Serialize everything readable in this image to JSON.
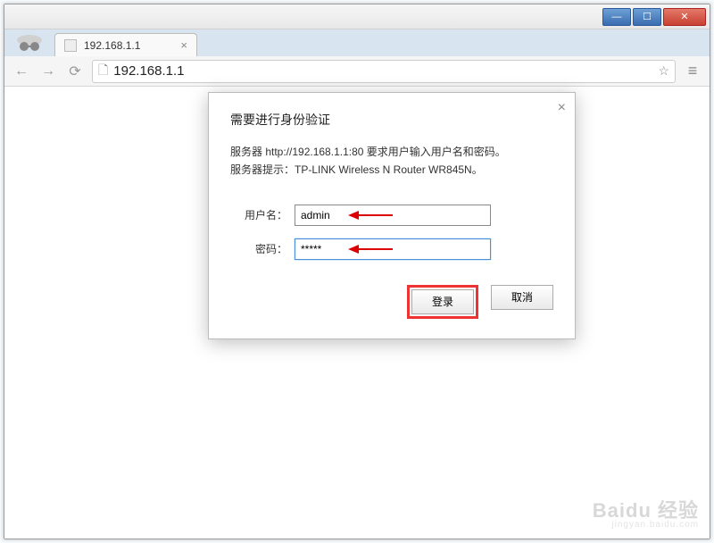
{
  "window": {
    "min_glyph": "—",
    "max_glyph": "☐",
    "close_glyph": "✕"
  },
  "tab": {
    "title": "192.168.1.1",
    "close_glyph": "×"
  },
  "toolbar": {
    "back_glyph": "←",
    "forward_glyph": "→",
    "reload_glyph": "⟳",
    "url": "192.168.1.1",
    "star_glyph": "☆",
    "menu_glyph": "≡"
  },
  "dialog": {
    "title": "需要进行身份验证",
    "close_glyph": "×",
    "message_line1": "服务器 http://192.168.1.1:80 要求用户输入用户名和密码。",
    "message_line2": "服务器提示：TP-LINK Wireless N Router WR845N。",
    "username_label": "用户名：",
    "username_value": "admin",
    "password_label": "密码：",
    "password_value": "*****",
    "login_label": "登录",
    "cancel_label": "取消"
  },
  "watermark": {
    "brand": "Baidu 经验",
    "sub": "jingyan.baidu.com"
  }
}
